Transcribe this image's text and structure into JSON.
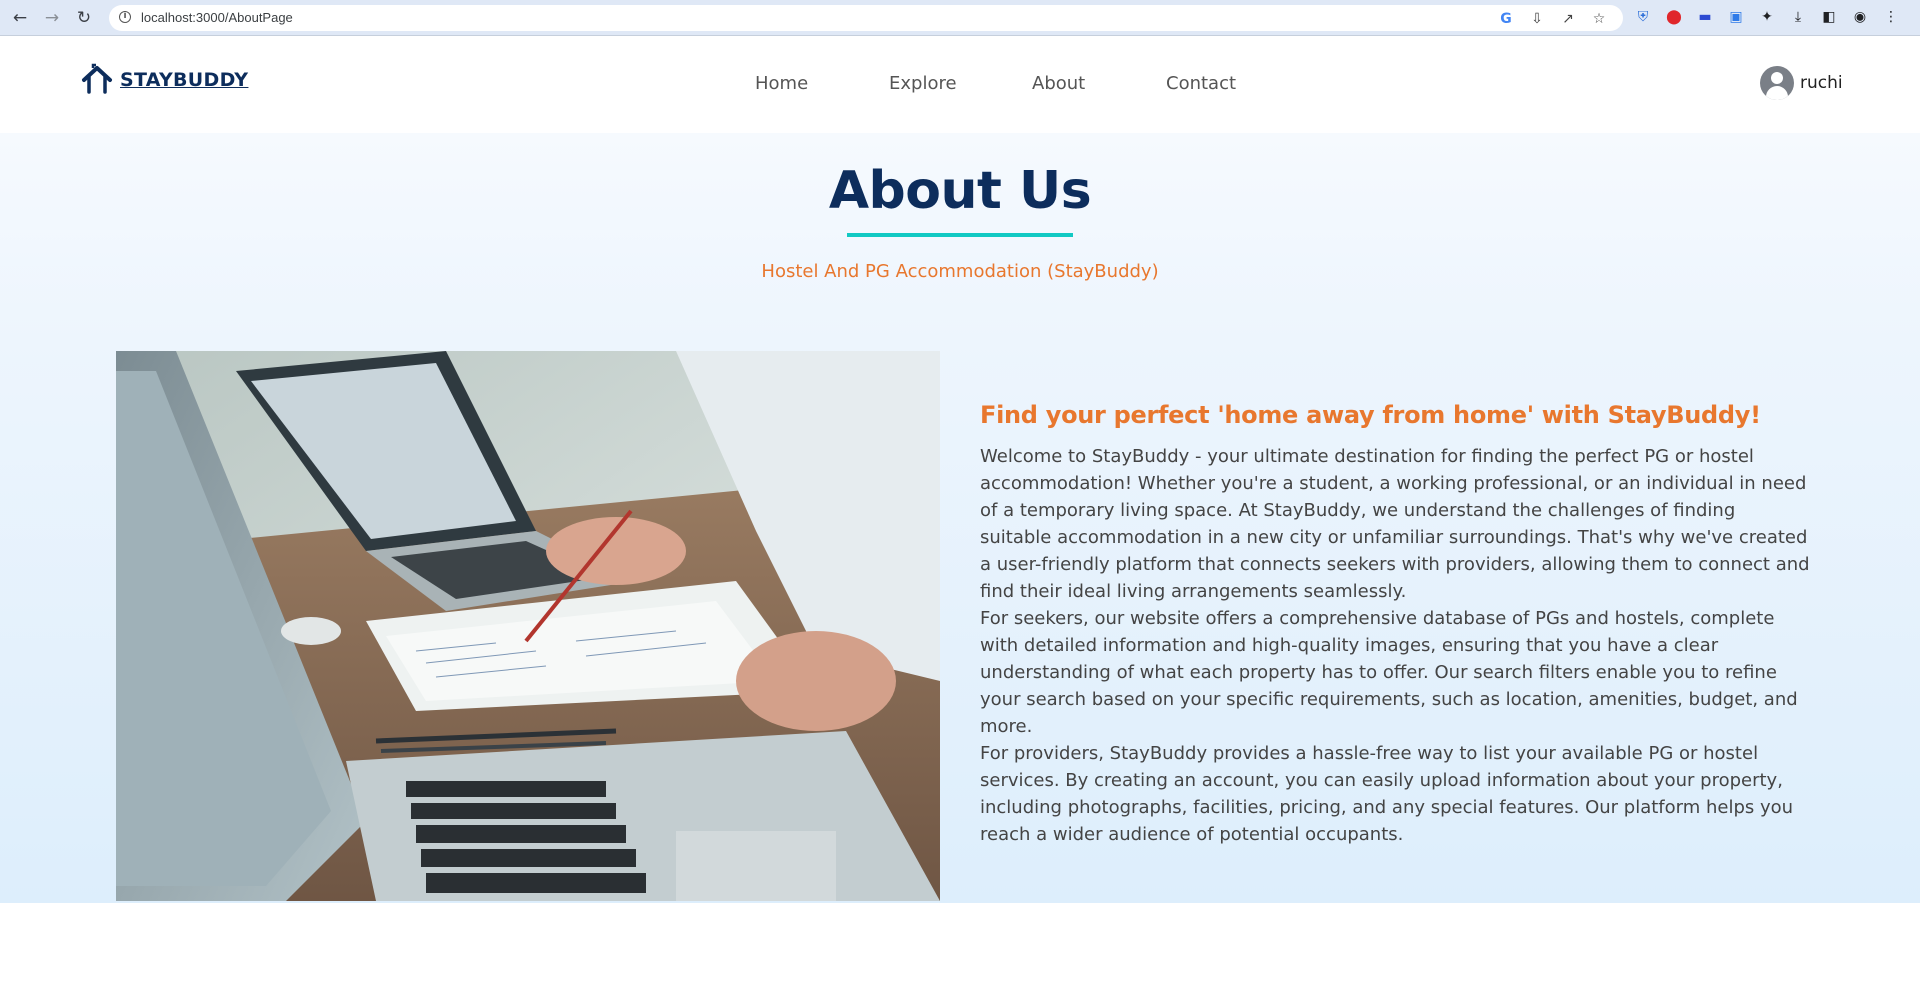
{
  "browser": {
    "url": "localhost:3000/AboutPage",
    "nav_icons": [
      "back-arrow-icon",
      "forward-arrow-icon",
      "reload-icon"
    ],
    "omnibox_icons": [
      "google-icon",
      "install-app-icon",
      "share-icon",
      "bookmark-star-icon"
    ],
    "extension_icons": [
      "shield-extension-icon",
      "opera-extension-icon",
      "window-extension-icon",
      "vpn-extension-icon",
      "puzzle-extensions-icon",
      "download-icon",
      "side-panel-icon",
      "profile-icon",
      "kebab-menu-icon"
    ]
  },
  "navbar": {
    "logo_text": "STAYBUDDY",
    "links": [
      "Home",
      "Explore",
      "About",
      "Contact"
    ],
    "user_name": "ruchi"
  },
  "hero": {
    "title": "About Us",
    "subtitle": "Hostel And PG Accommodation (StayBuddy)"
  },
  "about": {
    "heading": "Find your perfect 'home away from home' with StayBuddy!",
    "paragraph_1": "Welcome to StayBuddy - your ultimate destination for finding the perfect PG or hostel accommodation! Whether you're a student, a working professional, or an individual in need of a temporary living space. At StayBuddy, we understand the challenges of finding suitable accommodation in a new city or unfamiliar surroundings. That's why we've created a user-friendly platform that connects seekers with providers, allowing them to connect and find their ideal living arrangements seamlessly.",
    "paragraph_2": "For seekers, our website offers a comprehensive database of PGs and hostels, complete with detailed information and high-quality images, ensuring that you have a clear understanding of what each property has to offer. Our search filters enable you to refine your search based on your specific requirements, such as location, amenities, budget, and more.",
    "paragraph_3": "For providers, StayBuddy provides a hassle-free way to list your available PG or hostel services. By creating an account, you can easily upload information about your property, including photographs, facilities, pricing, and any special features. Our platform helps you reach a wider audience of potential occupants."
  },
  "colors": {
    "brand_navy": "#0d2d5c",
    "accent_orange": "#e8772e",
    "underline_teal": "#12c9c3"
  }
}
